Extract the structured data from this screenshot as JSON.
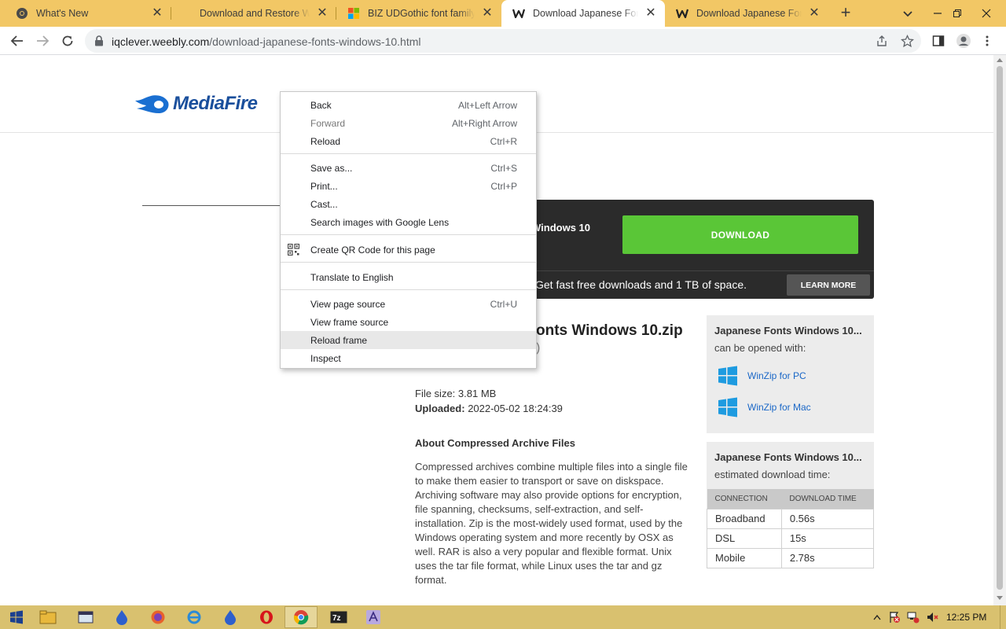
{
  "tabs": [
    {
      "title": "What's New",
      "icon": "chrome-icon",
      "active": false
    },
    {
      "title": "Download and Restore Windows",
      "icon": "none",
      "active": false
    },
    {
      "title": "BIZ UDGothic font family - Google",
      "icon": "windows-icon",
      "active": false
    },
    {
      "title": "Download Japanese Fonts Windows",
      "icon": "weebly-icon",
      "active": true
    },
    {
      "title": "Download Japanese Fonts Windows",
      "icon": "weebly-icon",
      "active": false
    }
  ],
  "address_bar": {
    "url_host": "iqclever.weebly.com",
    "url_path": "/download-japanese-fonts-windows-10.html"
  },
  "mediafire": {
    "logo_text": "MediaFire",
    "banner_filename": "Windows 10",
    "download_label": "DOWNLOAD",
    "promo_text": "Get fast free downloads and 1 TB of space.",
    "learn_more_label": "LEARN MORE"
  },
  "file": {
    "name_partial": "onts Windows 10.zip",
    "paren_partial": ")",
    "size_label": "File size:",
    "size_value": "3.81 MB",
    "uploaded_label": "Uploaded:",
    "uploaded_value": "2022-05-02 18:24:39"
  },
  "about": {
    "title": "About Compressed Archive Files",
    "text": "Compressed archives combine multiple files into a single file to make them easier to transport or save on diskspace. Archiving software may also provide options for encryption, file spanning, checksums, self-extraction, and self-installation. Zip is the most-widely used format, used by the Windows operating system and more recently by OSX as well. RAR is also a very popular and flexible format. Unix uses the tar file format, while Linux uses the tar and gz format."
  },
  "side_open": {
    "heading": "Japanese Fonts Windows 10...",
    "subtitle": "can be opened with:",
    "links": [
      "WinZip for PC",
      "WinZip for Mac"
    ]
  },
  "side_time": {
    "heading": "Japanese Fonts Windows 10...",
    "subtitle": "estimated download time:",
    "columns": [
      "CONNECTION",
      "DOWNLOAD TIME"
    ],
    "rows": [
      [
        "Broadband",
        "0.56s"
      ],
      [
        "DSL",
        "15s"
      ],
      [
        "Mobile",
        "2.78s"
      ]
    ]
  },
  "context_menu": {
    "items": [
      {
        "label": "Back",
        "shortcut": "Alt+Left Arrow",
        "disabled": false
      },
      {
        "label": "Forward",
        "shortcut": "Alt+Right Arrow",
        "disabled": true
      },
      {
        "label": "Reload",
        "shortcut": "Ctrl+R",
        "disabled": false
      },
      {
        "label": "Save as...",
        "shortcut": "Ctrl+S",
        "disabled": false
      },
      {
        "label": "Print...",
        "shortcut": "Ctrl+P",
        "disabled": false
      },
      {
        "label": "Cast...",
        "shortcut": "",
        "disabled": false
      },
      {
        "label": "Search images with Google Lens",
        "shortcut": "",
        "disabled": false
      },
      {
        "label": "Create QR Code for this page",
        "shortcut": "",
        "disabled": false
      },
      {
        "label": "Translate to English",
        "shortcut": "",
        "disabled": false
      },
      {
        "label": "View page source",
        "shortcut": "Ctrl+U",
        "disabled": false
      },
      {
        "label": "View frame source",
        "shortcut": "",
        "disabled": false
      },
      {
        "label": "Reload frame",
        "shortcut": "",
        "disabled": false,
        "highlighted": true
      },
      {
        "label": "Inspect",
        "shortcut": "",
        "disabled": false
      }
    ]
  },
  "taskbar": {
    "clock": "12:25 PM"
  },
  "colors": {
    "tabstrip": "#f2c765",
    "download_green": "#5ac637",
    "banner_dark": "#2b2b2b",
    "taskbar": "#d9c16f",
    "link_blue": "#1a67c7"
  }
}
